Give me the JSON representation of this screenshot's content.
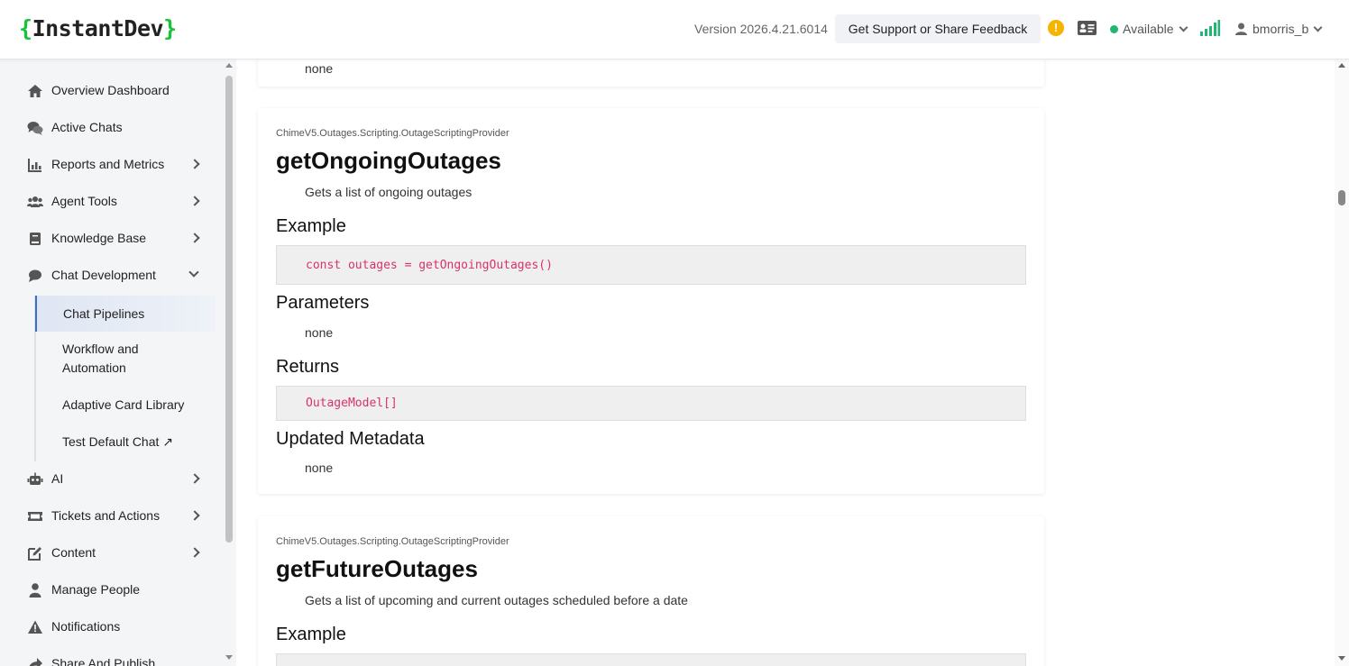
{
  "header": {
    "logo": {
      "open": "{",
      "name": "InstantDev",
      "close": "}"
    },
    "version": "Version 2026.4.21.6014",
    "support_label": "Get Support or Share Feedback",
    "alert_glyph": "!",
    "status_label": "Available",
    "username": "bmorris_b",
    "colors": {
      "brand_bracket": "#19c23a",
      "status_dot": "#22b573",
      "alert": "#f5b400"
    }
  },
  "sidebar": {
    "items": [
      {
        "label": "Overview Dashboard",
        "icon": "home-icon"
      },
      {
        "label": "Active Chats",
        "icon": "chat-bubbles-icon"
      },
      {
        "label": "Reports and Metrics",
        "icon": "bar-chart-icon"
      },
      {
        "label": "Agent Tools",
        "icon": "users-icon"
      },
      {
        "label": "Knowledge Base",
        "icon": "book-icon"
      },
      {
        "label": "Chat Development",
        "icon": "comment-icon",
        "expanded": true
      },
      {
        "label": "AI",
        "icon": "robot-icon"
      },
      {
        "label": "Tickets and Actions",
        "icon": "ticket-icon"
      },
      {
        "label": "Content",
        "icon": "edit-icon"
      },
      {
        "label": "Manage People",
        "icon": "person-icon"
      },
      {
        "label": "Notifications",
        "icon": "warning-icon"
      },
      {
        "label": "Share And Publish",
        "icon": "share-icon"
      }
    ],
    "sub_items": [
      {
        "label": "Chat Pipelines",
        "active": true
      },
      {
        "label": "Workflow and Automation"
      },
      {
        "label": "Adaptive Card Library"
      },
      {
        "label": "Test Default Chat ↗"
      }
    ]
  },
  "main": {
    "top_partial": {
      "text": "none"
    },
    "cards": [
      {
        "namespace": "ChimeV5.Outages.Scripting.OutageScriptingProvider",
        "name": "getOngoingOutages",
        "description": "Gets a list of ongoing outages",
        "example_heading": "Example",
        "example_code": "const outages = getOngoingOutages()",
        "parameters_heading": "Parameters",
        "parameters": "none",
        "returns_heading": "Returns",
        "returns_code": "OutageModel[]",
        "metadata_heading": "Updated Metadata",
        "metadata": "none"
      },
      {
        "namespace": "ChimeV5.Outages.Scripting.OutageScriptingProvider",
        "name": "getFutureOutages",
        "description": "Gets a list of upcoming and current outages scheduled before a date",
        "example_heading": "Example"
      }
    ]
  }
}
